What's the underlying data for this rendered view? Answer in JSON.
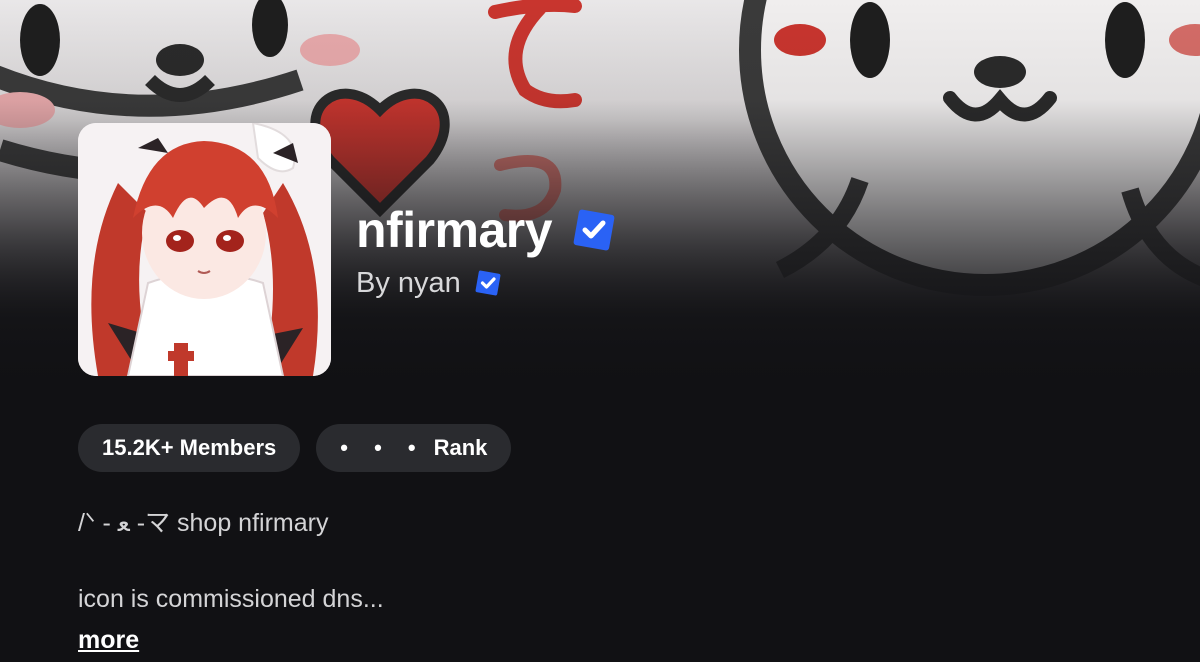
{
  "group": {
    "name": "nfirmary",
    "owner_prefix": "By",
    "owner": "nyan",
    "byline": "By nyan",
    "verified_icon": "verified-check-icon",
    "accent_color": "#2a62f5"
  },
  "stats": {
    "members_label": "15.2K+ Members",
    "rank_dots": "• • •",
    "rank_label": "Rank"
  },
  "description": {
    "line1": "/ᐠ - ﻌ -マ   shop nfirmary",
    "line2": "icon is commissioned dns...",
    "more_label": "more"
  },
  "banner": {
    "background_color": "#111114",
    "art": "white-cat-faces-with-red-hearts"
  }
}
